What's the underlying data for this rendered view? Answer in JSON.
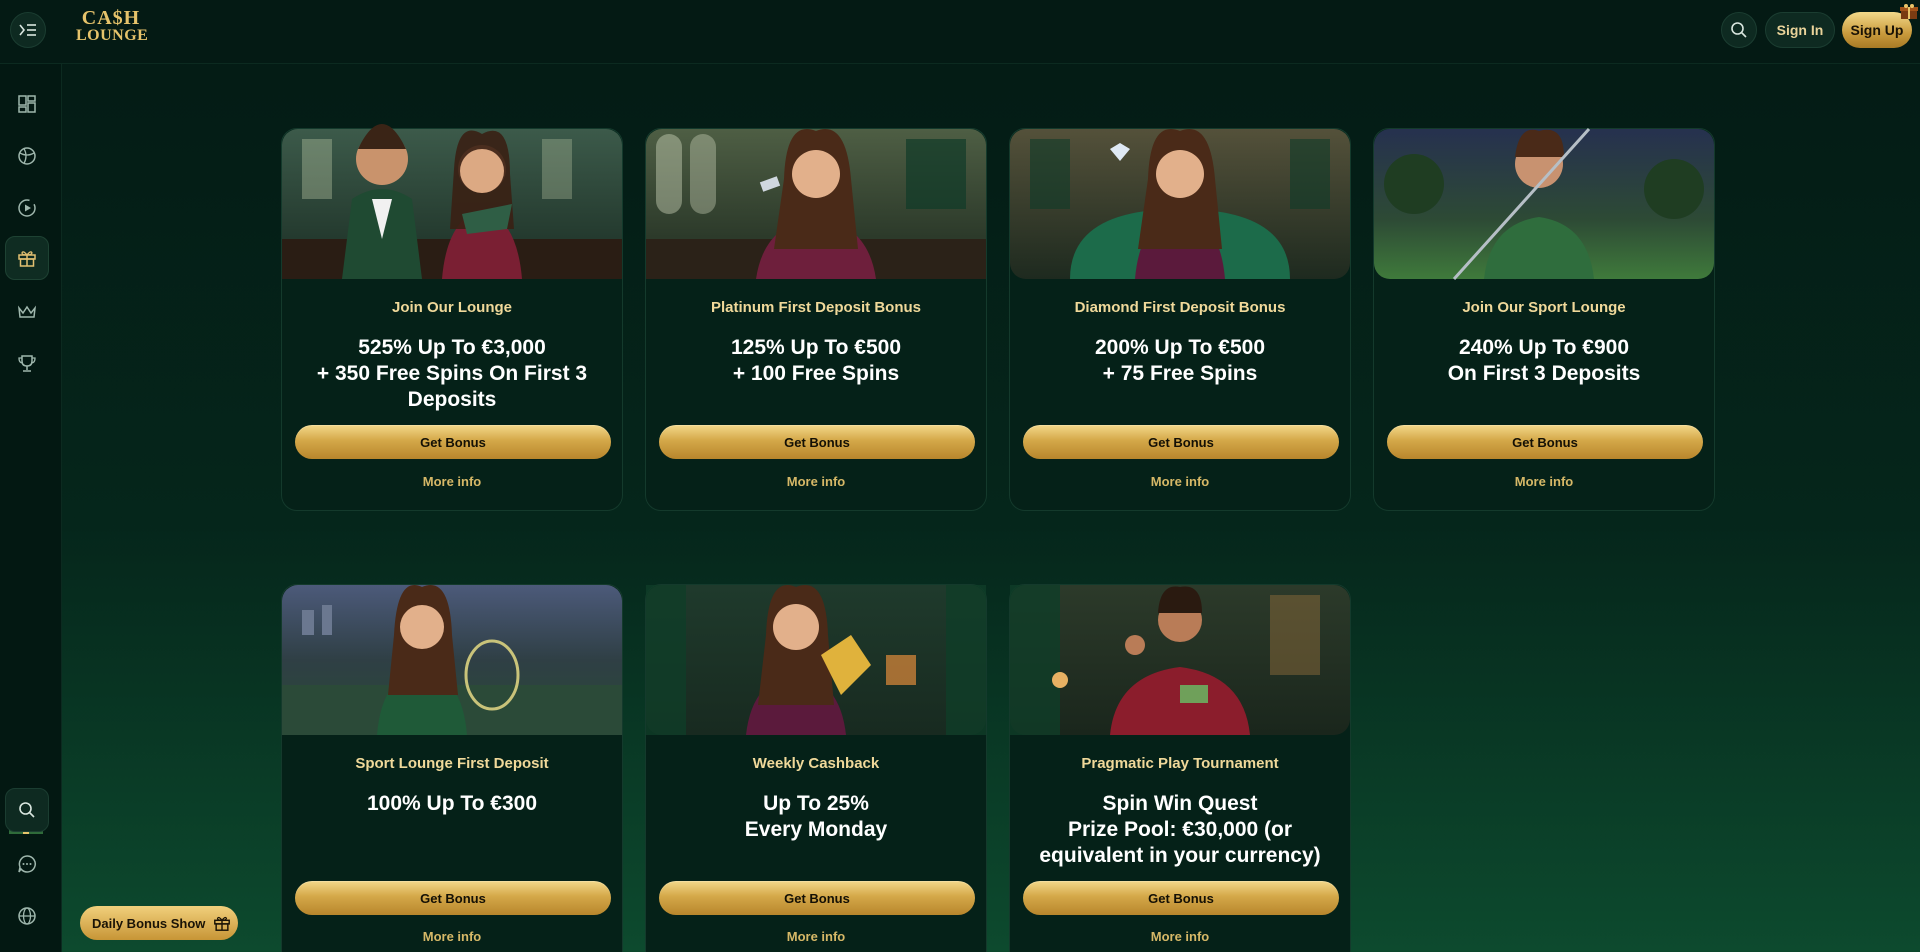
{
  "header": {
    "logo_line1": "CA$H",
    "logo_line2": "LOUNGE",
    "search_icon": "search-icon",
    "sign_in": "Sign In",
    "sign_up": "Sign Up"
  },
  "sidebar": {
    "items": [
      {
        "name": "dashboard-icon"
      },
      {
        "name": "sports-ball-icon"
      },
      {
        "name": "live-play-icon"
      },
      {
        "name": "gift-icon"
      },
      {
        "name": "crown-icon"
      },
      {
        "name": "trophy-icon"
      },
      {
        "name": "search-icon"
      },
      {
        "name": "chat-icon"
      },
      {
        "name": "globe-icon"
      }
    ],
    "daily_bonus": "Daily Bonus Show"
  },
  "cards": [
    {
      "title": "Join Our Lounge",
      "offer": [
        "525% Up To €3,000",
        "+ 350 Free Spins On First 3",
        "Deposits"
      ],
      "button": "Get Bonus",
      "more": "More info"
    },
    {
      "title": "Platinum First Deposit Bonus",
      "offer": [
        "125% Up To €500",
        "+ 100 Free Spins"
      ],
      "button": "Get Bonus",
      "more": "More info"
    },
    {
      "title": "Diamond First Deposit Bonus",
      "offer": [
        "200% Up To €500",
        "+ 75 Free Spins"
      ],
      "button": "Get Bonus",
      "more": "More info"
    },
    {
      "title": "Join Our Sport Lounge",
      "offer": [
        "240% Up To €900",
        "On First 3 Deposits"
      ],
      "button": "Get Bonus",
      "more": "More info"
    },
    {
      "title": "Sport Lounge First Deposit",
      "offer": [
        "100% Up To €300"
      ],
      "button": "Get Bonus",
      "more": "More info"
    },
    {
      "title": "Weekly Cashback",
      "offer": [
        "Up To 25%",
        "Every Monday"
      ],
      "button": "Get Bonus",
      "more": "More info"
    },
    {
      "title": "Pragmatic Play Tournament",
      "offer": [
        "Spin Win Quest",
        "Prize Pool: €30,000 (or",
        "equivalent in your currency)"
      ],
      "button": "Get Bonus",
      "more": "More info"
    }
  ],
  "colors": {
    "accent_gold": "#d4a849",
    "title_gold": "#f0d99a",
    "background": "#041a14",
    "card": "#052118"
  }
}
